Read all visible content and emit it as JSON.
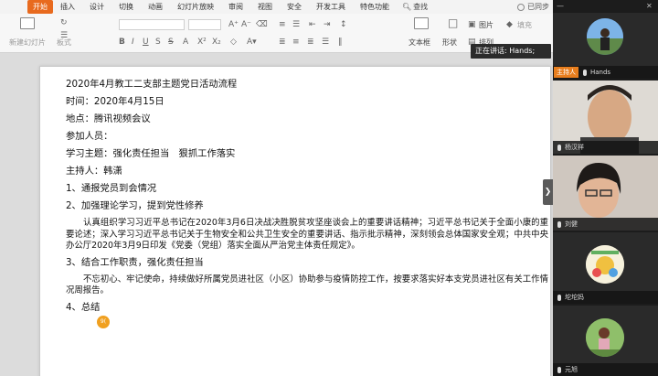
{
  "menu": {
    "start": "开始",
    "items": [
      "插入",
      "设计",
      "切换",
      "动画",
      "幻灯片放映",
      "审阅",
      "视图",
      "安全",
      "开发工具",
      "特色功能"
    ],
    "search": "查找",
    "sync": "已同步"
  },
  "ribbon": {
    "new_slide": "新建幻灯片",
    "format": "板式",
    "text_box": "文本框",
    "shape": "形状",
    "image": "图片",
    "fill": "填充",
    "arrange": "排列"
  },
  "tooltip": {
    "speaking": "正在讲话: Hands;"
  },
  "document": {
    "title": "2020年4月教工二支部主题党日活动流程",
    "time": "时间：2020年4月15日",
    "place": "地点：腾讯视频会议",
    "attendees": "参加人员：",
    "theme": "学习主题：强化责任担当　狠抓工作落实",
    "host": "主持人：韩潇",
    "item1": "1、通报党员到会情况",
    "item2": "2、加强理论学习，提到党性修养",
    "para1": "认真组织学习习近平总书记在2020年3月6日决战决胜脱贫攻坚座谈会上的重要讲话精神；习近平总书记关于全面小康的重要论述；深入学习习近平总书记关于生物安全和公共卫生安全的重要讲话、指示批示精神，深刻领会总体国家安全观；中共中央办公厅2020年3月9日印发《党委（党组）落实全面从严治党主体责任规定》。",
    "item3": "3、结合工作职责，强化责任担当",
    "para2": "不忘初心、牢记使命，持续做好所属党员进社区（小区）协助参与疫情防控工作，按要求落实好本支党员进社区有关工作情况周报告。",
    "item4": "4、总结"
  },
  "participants": [
    {
      "name": "Hands",
      "role": "主持人"
    },
    {
      "name": "杨汉祥"
    },
    {
      "name": "刘健"
    },
    {
      "name": "坨坨妈"
    },
    {
      "name": "元旭"
    }
  ],
  "badge": "9(",
  "colors": {
    "accent": "#e86a1e",
    "host": "#e87e1e"
  }
}
